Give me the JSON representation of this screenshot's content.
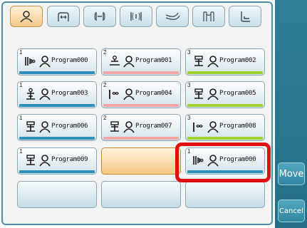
{
  "colors": {
    "blue": "#2e8fb6",
    "pink": "#f2a7a7",
    "green": "#a3d12d"
  },
  "tabs": [
    {
      "icon": "user-icon",
      "active": true
    },
    {
      "icon": "arm-icon",
      "active": false
    },
    {
      "icon": "depth-icon",
      "active": false
    },
    {
      "icon": "width-icon",
      "active": false
    },
    {
      "icon": "foot-icon",
      "active": false
    },
    {
      "icon": "legs-icon",
      "active": false
    },
    {
      "icon": "seat-icon",
      "active": false
    }
  ],
  "programs": [
    {
      "num": "1",
      "name": "Program000",
      "cond": "chair-icon",
      "bar": "blue"
    },
    {
      "num": "2",
      "name": "Program001",
      "cond": "recline-icon",
      "bar": "pink"
    },
    {
      "num": "3",
      "name": "Program002",
      "cond": "stack-icon",
      "bar": "green"
    },
    {
      "num": "1",
      "name": "Program003",
      "cond": "lift-icon",
      "bar": "blue"
    },
    {
      "num": "2",
      "name": "Program004",
      "cond": "infinity-icon",
      "bar": "pink"
    },
    {
      "num": "3",
      "name": "Program005",
      "cond": "stack-icon",
      "bar": "green"
    },
    {
      "num": "1",
      "name": "Program006",
      "cond": "stack-icon",
      "bar": "blue"
    },
    {
      "num": "2",
      "name": "Program007",
      "cond": "stack-icon",
      "bar": "pink"
    },
    {
      "num": "3",
      "name": "Program008",
      "cond": "infinity-icon",
      "bar": "green"
    },
    {
      "num": "1",
      "name": "Program009",
      "cond": "stack-icon",
      "bar": "blue"
    },
    {
      "num": "",
      "name": "",
      "cond": "",
      "bar": "",
      "cursor": true
    },
    {
      "num": "1",
      "name": "Program000",
      "cond": "chair-icon",
      "bar": "blue"
    },
    {
      "num": "",
      "name": "",
      "cond": "",
      "bar": ""
    },
    {
      "num": "",
      "name": "",
      "cond": "",
      "bar": ""
    },
    {
      "num": "",
      "name": "",
      "cond": "",
      "bar": ""
    }
  ],
  "sidebar": {
    "move_label": "Move",
    "cancel_label": "Cancel"
  }
}
